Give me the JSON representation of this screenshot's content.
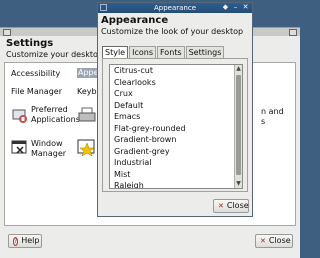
{
  "settings": {
    "title": "Settings",
    "subtitle": "Customize your desktop",
    "items": {
      "accessibility": "Accessibility",
      "appearance": "Appear",
      "file_manager": "File Manager",
      "keyboard": "Keybo",
      "preferred_1": "Preferred",
      "preferred_2": "Applications",
      "window_1": "Window",
      "window_2": "Manager",
      "right_edge_1": "n and",
      "right_edge_2": "s"
    },
    "help_label": "Help",
    "close_label": "Close"
  },
  "dialog": {
    "window_title": "Appearance",
    "title": "Appearance",
    "subtitle": "Customize the look of your desktop",
    "tabs": [
      "Style",
      "Icons",
      "Fonts",
      "Settings"
    ],
    "active_tab": "Style",
    "styles": [
      "Citrus-cut",
      "Clearlooks",
      "Crux",
      "Default",
      "Emacs",
      "Flat-grey-rounded",
      "Gradient-brown",
      "Gradient-grey",
      "Industrial",
      "Mist",
      "Raleigh"
    ],
    "close_label": "Close"
  },
  "colors": {
    "desktop": "#3f5f80",
    "titlebar_active": "#2e5f8f",
    "window_bg": "#ececea"
  }
}
